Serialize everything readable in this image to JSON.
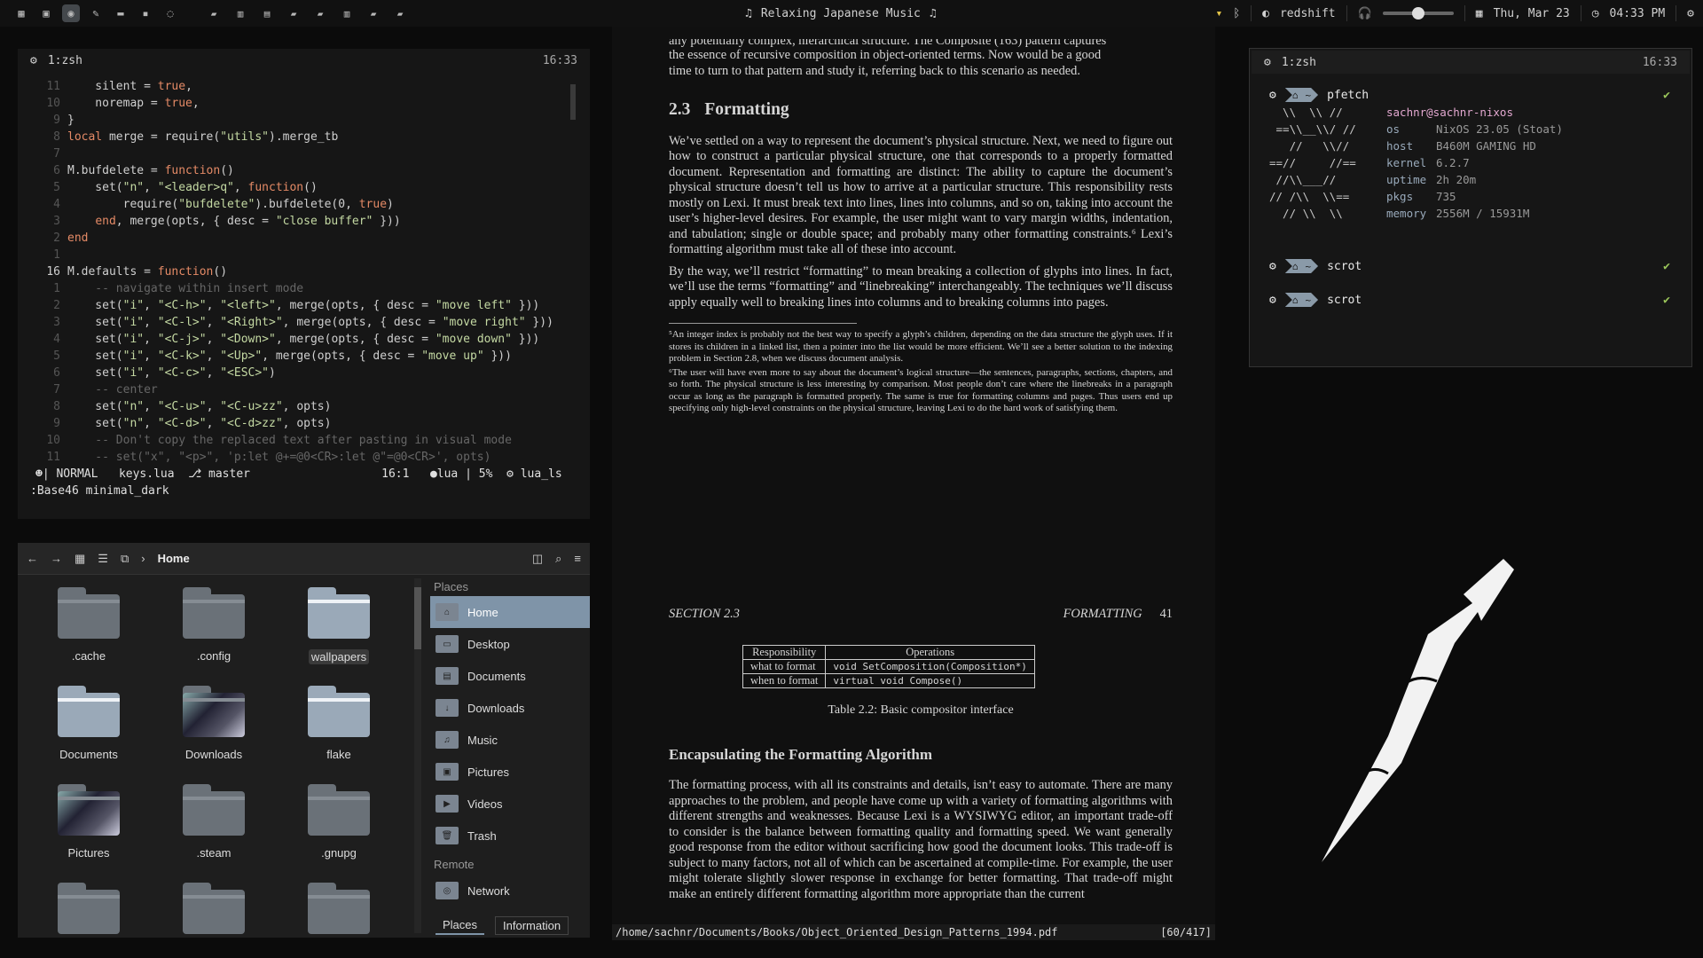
{
  "topbar": {
    "workspaces": [
      "1",
      "2",
      "3",
      "4",
      "5",
      "6",
      "7"
    ],
    "music_title": "Relaxing Japanese Music",
    "redshift_label": "redshift",
    "volume_level": 0.5,
    "date": "Thu, Mar 23",
    "time": "04:33 PM"
  },
  "nvim": {
    "tab_label": "1:zsh",
    "time": "16:33",
    "lines": [
      {
        "n": "11",
        "t": "    silent = true,"
      },
      {
        "n": "10",
        "t": "    noremap = true,"
      },
      {
        "n": "9",
        "t": "}"
      },
      {
        "n": "8",
        "t": "local merge = require(\"utils\").merge_tb"
      },
      {
        "n": "7",
        "t": ""
      },
      {
        "n": "6",
        "t": "M.bufdelete = function()"
      },
      {
        "n": "5",
        "t": "    set(\"n\", \"<leader>q\", function()"
      },
      {
        "n": "4",
        "t": "        require(\"bufdelete\").bufdelete(0, true)"
      },
      {
        "n": "3",
        "t": "    end, merge(opts, { desc = \"close buffer\" }))"
      },
      {
        "n": "2",
        "t": "end"
      },
      {
        "n": "1",
        "t": ""
      },
      {
        "n": "16",
        "t": "M.defaults = function()"
      },
      {
        "n": "1",
        "t": "    -- navigate within insert mode"
      },
      {
        "n": "2",
        "t": "    set(\"i\", \"<C-h>\", \"<left>\", merge(opts, { desc = \"move left\" }))"
      },
      {
        "n": "3",
        "t": "    set(\"i\", \"<C-l>\", \"<Right>\", merge(opts, { desc = \"move right\" }))"
      },
      {
        "n": "4",
        "t": "    set(\"i\", \"<C-j>\", \"<Down>\", merge(opts, { desc = \"move down\" }))"
      },
      {
        "n": "5",
        "t": "    set(\"i\", \"<C-k>\", \"<Up>\", merge(opts, { desc = \"move up\" }))"
      },
      {
        "n": "6",
        "t": "    set(\"i\", \"<C-c>\", \"<ESC>\")"
      },
      {
        "n": "7",
        "t": "    -- center"
      },
      {
        "n": "8",
        "t": "    set(\"n\", \"<C-u>\", \"<C-u>zz\", opts)"
      },
      {
        "n": "9",
        "t": "    set(\"n\", \"<C-d>\", \"<C-d>zz\", opts)"
      },
      {
        "n": "10",
        "t": "    -- Don't copy the replaced text after pasting in visual mode"
      },
      {
        "n": "11",
        "t": "    -- set(\"x\", \"<p>\", 'p:let @+=@0<CR>:let @\"=@0<CR>', opts)"
      }
    ],
    "status": {
      "mode": "NORMAL",
      "file": "keys.lua",
      "branch": "master",
      "position": "16:1",
      "filetype": "lua",
      "percent": "5%",
      "lsp": "lua_ls"
    },
    "cmdline": ":Base46 minimal_dark"
  },
  "filemanager": {
    "location": "Home",
    "items": [
      {
        "label": ".cache",
        "style": "dark"
      },
      {
        "label": ".config",
        "style": "dark"
      },
      {
        "label": "wallpapers",
        "style": "light"
      },
      {
        "label": "Documents",
        "style": "light"
      },
      {
        "label": "Downloads",
        "style": "img"
      },
      {
        "label": "flake",
        "style": "light"
      },
      {
        "label": "Pictures",
        "style": "img"
      },
      {
        "label": ".steam",
        "style": "dark"
      },
      {
        "label": ".gnupg",
        "style": "dark"
      }
    ],
    "places_header": "Places",
    "places": [
      "Home",
      "Desktop",
      "Documents",
      "Downloads",
      "Music",
      "Pictures",
      "Videos",
      "Trash"
    ],
    "remote_header": "Remote",
    "remote": [
      "Network"
    ],
    "tabs": [
      "Places",
      "Information"
    ]
  },
  "pdf": {
    "top_line_1": "any potentially complex, hierarchical structure. The Composite (163) pattern captures",
    "top_line_2": "the essence of recursive composition in object-oriented terms. Now would be a good",
    "top_line_3": "time to turn to that pattern and study it, referring back to this scenario as needed.",
    "section_num": "2.3",
    "section_title": "Formatting",
    "para1": "We’ve settled on a way to represent the document’s physical structure. Next, we need to figure out how to construct a particular physical structure, one that corresponds to a properly formatted document. Representation and formatting are distinct: The ability to capture the document’s physical structure doesn’t tell us how to arrive at a particular structure. This responsibility rests mostly on Lexi. It must break text into lines, lines into columns, and so on, taking into account the user’s higher-level desires. For example, the user might want to vary margin widths, indentation, and tabulation; single or double space; and probably many other formatting constraints.⁶ Lexi’s formatting algorithm must take all of these into account.",
    "para2": "By the way, we’ll restrict “formatting” to mean breaking a collection of glyphs into lines. In fact, we’ll use the terms “formatting” and “linebreaking” interchangeably. The techniques we’ll discuss apply equally well to breaking lines into columns and to breaking columns into pages.",
    "fn5": "⁵An integer index is probably not the best way to specify a glyph’s children, depending on the data structure the glyph uses. If it stores its children in a linked list, then a pointer into the list would be more efficient. We’ll see a better solution to the indexing problem in Section 2.8, when we discuss document analysis.",
    "fn6": "⁶The user will have even more to say about the document’s logical structure—the sentences, paragraphs, sections, chapters, and so forth. The physical structure is less interesting by comparison. Most people don’t care where the linebreaks in a paragraph occur as long as the paragraph is formatted properly. The same is true for formatting columns and pages. Thus users end up specifying only high-level constraints on the physical structure, leaving Lexi to do the hard work of satisfying them.",
    "running_left": "SECTION 2.3",
    "running_right": "FORMATTING",
    "page_num": "41",
    "table": {
      "headers": [
        "Responsibility",
        "Operations"
      ],
      "rows": [
        [
          "what to format",
          "void SetComposition(Composition*)"
        ],
        [
          "when to format",
          "virtual void Compose()"
        ]
      ]
    },
    "table_caption": "Table 2.2: Basic compositor interface",
    "subheading": "Encapsulating the Formatting Algorithm",
    "para3": "The formatting process, with all its constraints and details, isn’t easy to automate. There are many approaches to the problem, and people have come up with a variety of formatting algorithms with different strengths and weaknesses. Because Lexi is a WYSIWYG editor, an important trade-off to consider is the balance between formatting quality and formatting speed. We want generally good response from the editor without sacrificing how good the document looks. This trade-off is subject to many factors, not all of which can be ascertained at compile-time. For example, the user might tolerate slightly slower response in exchange for better formatting. That trade-off might make an entirely different formatting algorithm more appropriate than the current",
    "statusbar_path": "/home/sachnr/Documents/Books/Object_Oriented_Design_Patterns_1994.pdf",
    "statusbar_page": "[60/417]"
  },
  "term2": {
    "tab_label": "1:zsh",
    "time": "16:33",
    "prompts": [
      {
        "cmd": "pfetch",
        "ok": "✔"
      },
      {
        "cmd": "scrot",
        "ok": "✔"
      },
      {
        "cmd": "scrot",
        "ok": "✔"
      }
    ],
    "home_glyph": "~",
    "userhost": "sachnr@sachnr-nixos",
    "logo": [
      "  \\\\  \\\\ //",
      " ==\\\\__\\\\/ //",
      "   //   \\\\//",
      "==//     //==",
      " //\\\\___//",
      "// /\\\\  \\\\==",
      "  // \\\\  \\\\"
    ],
    "info": [
      {
        "k": "os",
        "v": "NixOS 23.05 (Stoat)"
      },
      {
        "k": "host",
        "v": "B460M GAMING HD"
      },
      {
        "k": "kernel",
        "v": "6.2.7"
      },
      {
        "k": "uptime",
        "v": "2h 20m"
      },
      {
        "k": "pkgs",
        "v": "735"
      },
      {
        "k": "memory",
        "v": "2556M / 15931M"
      }
    ]
  }
}
